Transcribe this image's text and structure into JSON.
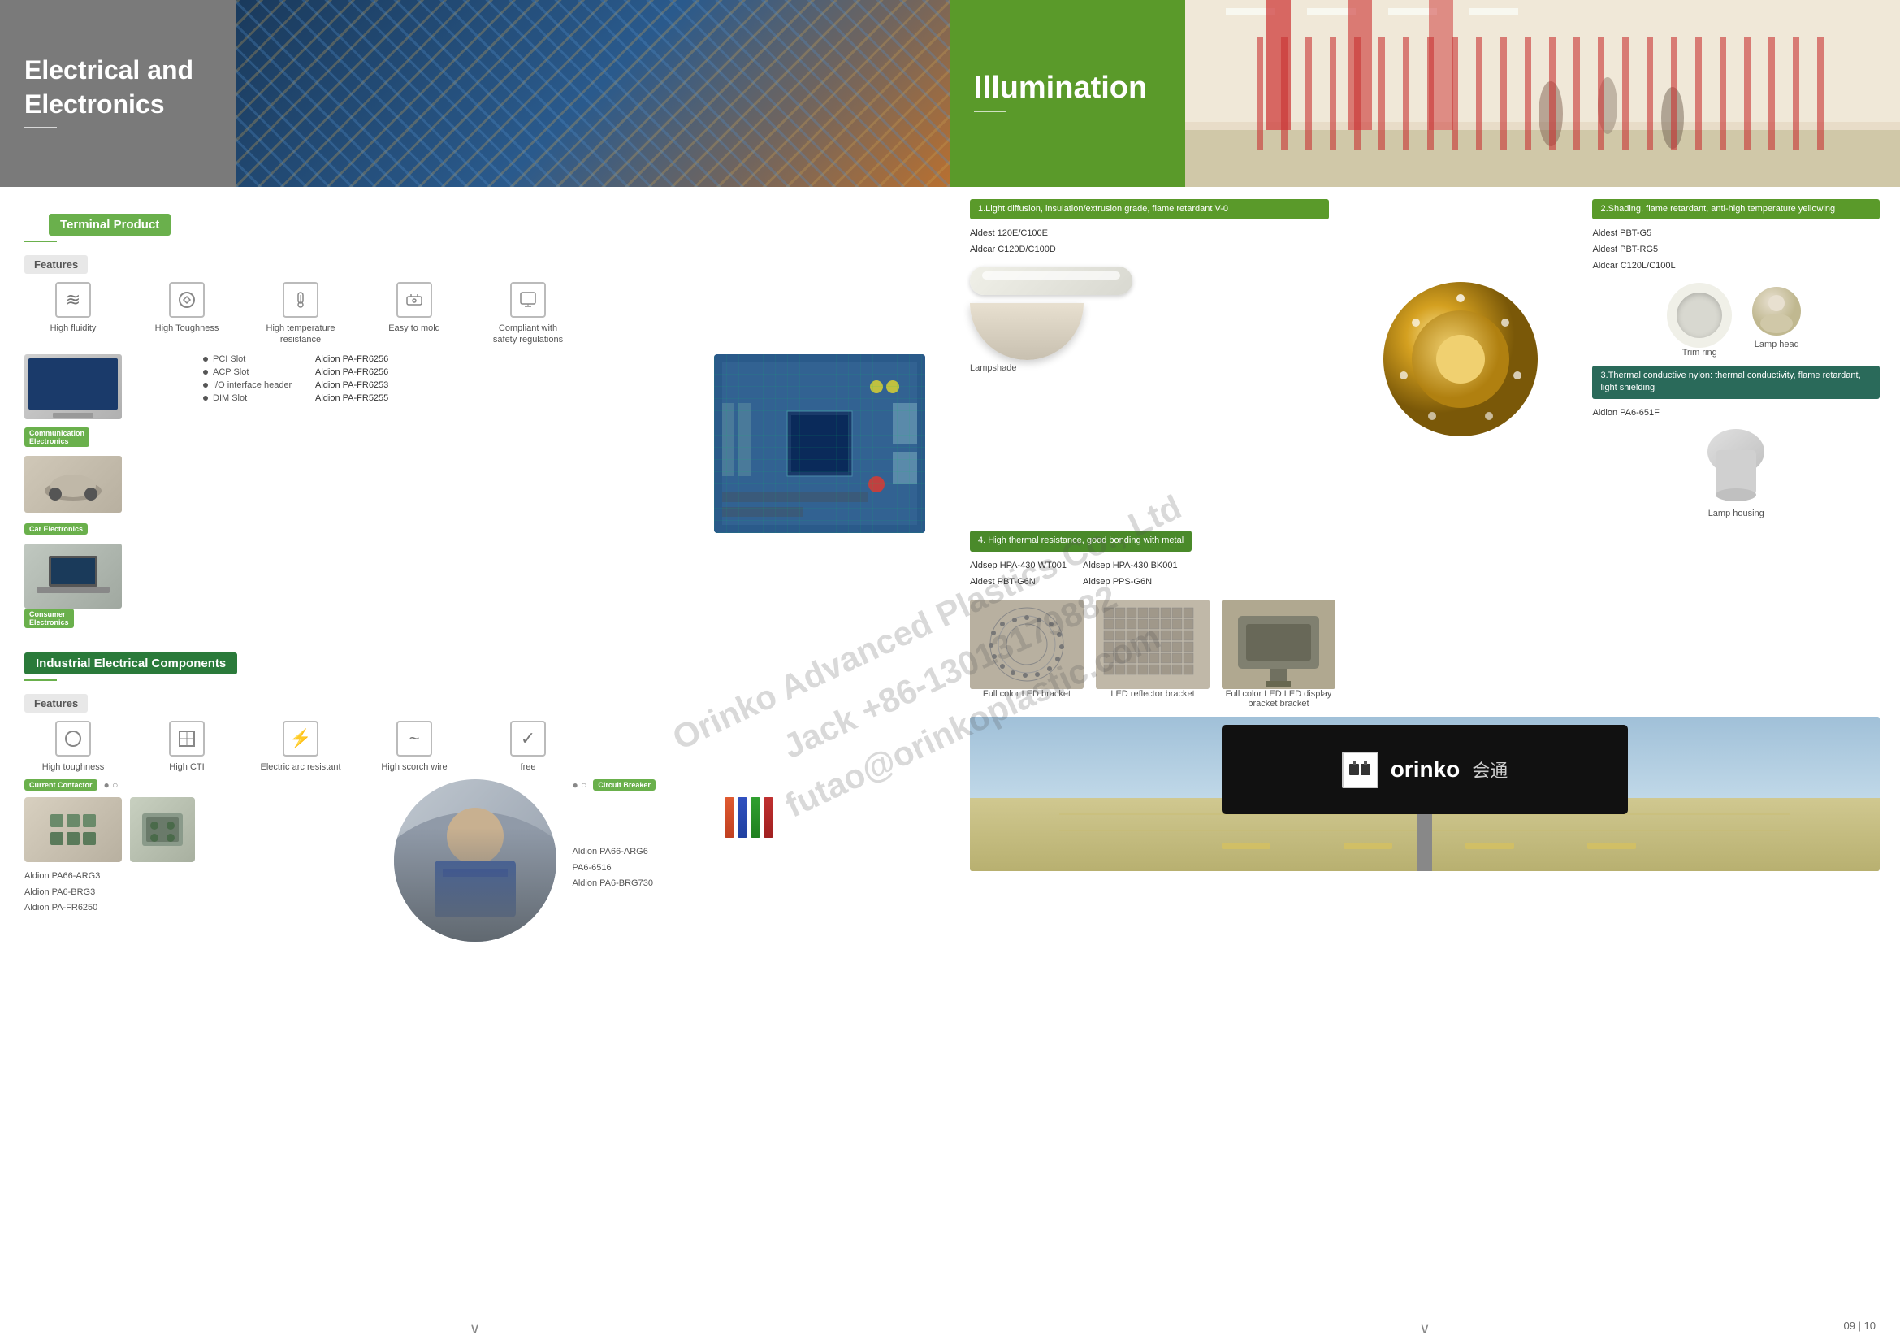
{
  "left": {
    "header": {
      "title_line1": "Electrical and",
      "title_line2": "Electronics"
    },
    "terminal_badge": "Terminal Product",
    "features_label": "Features",
    "terminal_features": [
      {
        "icon": "≋",
        "label": "High fluidity"
      },
      {
        "icon": "⚙",
        "label": "High Toughness"
      },
      {
        "icon": "🌡",
        "label": "High temperature\nresistance"
      },
      {
        "icon": "⬡",
        "label": "Easy to mold"
      },
      {
        "icon": "✔",
        "label": "Compliant with\nsafety regulations"
      }
    ],
    "communication_tag": "Communication\nElectronics",
    "car_tag": "Car Electronics",
    "consumer_tag": "Consumer\nElectronics",
    "slots": [
      {
        "dot": true,
        "label": "PCI Slot",
        "value": "Aldion PA-FR6256"
      },
      {
        "dot": true,
        "label": "ACP Slot",
        "value": "Aldion PA-FR6256"
      },
      {
        "dot": true,
        "label": "I/O interface header",
        "value": "Aldion PA-FR6253"
      },
      {
        "dot": true,
        "label": "DIM Slot",
        "value": "Aldion PA-FR5255"
      }
    ],
    "industrial_badge": "Industrial Electrical Components",
    "industrial_features_label": "Features",
    "industrial_features": [
      {
        "icon": "◈",
        "label": "High toughness"
      },
      {
        "icon": "⊞",
        "label": "High CTI"
      },
      {
        "icon": "⚡",
        "label": "Electric arc\nresistant"
      },
      {
        "icon": "~",
        "label": "High scorch wire"
      },
      {
        "icon": "✓",
        "label": "free"
      }
    ],
    "current_contactor_tag": "Current Contactor",
    "current_contactor_parts": [
      "Aldion PA66-ARG3",
      "Aldion PA6-BRG3",
      "Aldion PA-FR6250"
    ],
    "circuit_breaker_tag": "Circuit Breaker",
    "circuit_breaker_parts": [
      "Aldion PA66-ARG6",
      "PA6-6516",
      "Aldion PA6-BRG730"
    ]
  },
  "right": {
    "header": {
      "title": "Illumination"
    },
    "section1": {
      "label": "1.Light diffusion, insulation/extrusion grade, flame retardant V-0",
      "items": [
        "Aldest 120E/C100E",
        "Aldcar C120D/C100D"
      ]
    },
    "section2": {
      "label": "2.Shading, flame retardant, anti-high temperature yellowing",
      "items": [
        "Aldest PBT-G5",
        "Aldest PBT-RG5",
        "Aldcar C120L/C100L"
      ]
    },
    "section3": {
      "label": "3.Thermal conductive nylon: thermal conductivity, flame retardant, light shielding",
      "items": [
        "Aldion PA6-651F"
      ]
    },
    "section4": {
      "label": "4. High thermal resistance, good bonding with metal",
      "items": [
        "Aldsep HPA-430 WT001",
        "Aldsep HPA-430 BK001",
        "Aldest PBT-G6N",
        "Aldsep PPS-G6N"
      ]
    },
    "lamp_parts": [
      {
        "label": "Lampshade"
      },
      {
        "label": "Trim ring"
      },
      {
        "label": "Lamp head"
      }
    ],
    "lamp_housing_label": "Lamp housing",
    "led_parts": [
      {
        "label": "Full color LED bracket"
      },
      {
        "label": "LED reflector bracket"
      },
      {
        "label": "Full color LED LED\ndisplay bracket bracket"
      }
    ],
    "billboard": {
      "logo_text": "orinko",
      "logo_chinese": "会通"
    },
    "page_numbers": "09 | 10"
  },
  "watermark": {
    "line1": "Orinko Advanced Plastics Co., Ltd",
    "line2": "Jack +86-13013179882",
    "line3": "futao@orinkoplastic.com"
  }
}
